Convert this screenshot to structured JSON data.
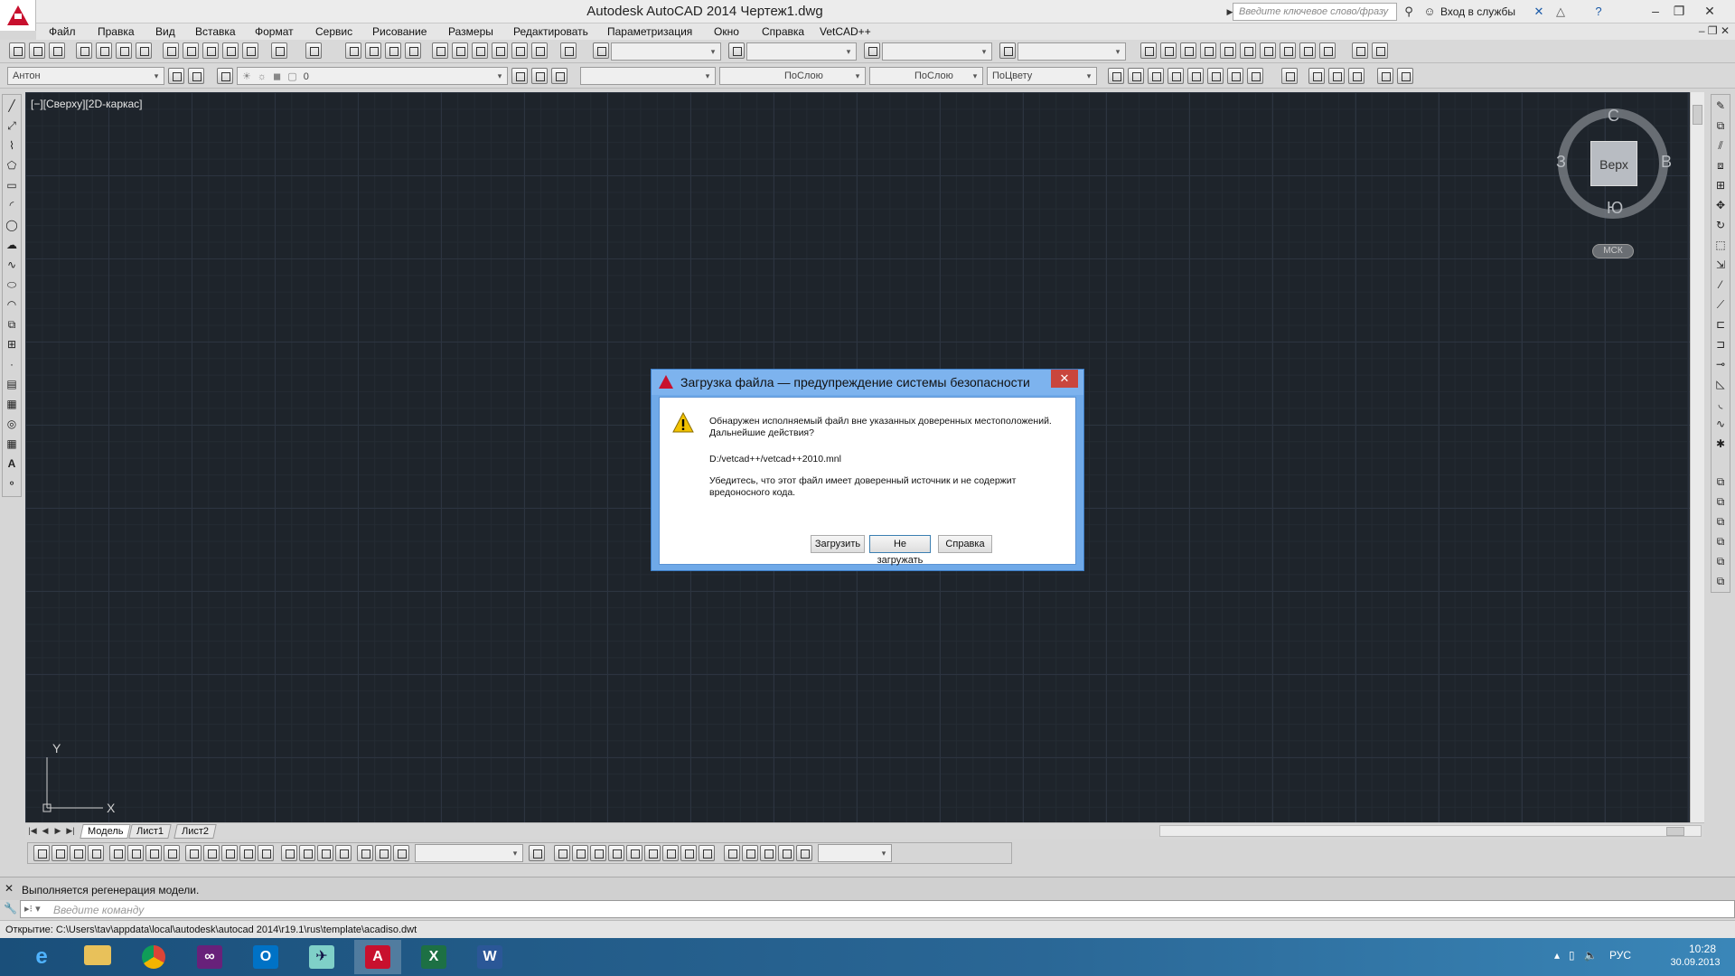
{
  "window": {
    "title": "Autodesk AutoCAD 2014    Чертеж1.dwg",
    "search_placeholder": "Введите ключевое слово/фразу",
    "signin_label": "Вход в службы"
  },
  "menu": [
    "Файл",
    "Правка",
    "Вид",
    "Вставка",
    "Формат",
    "Сервис",
    "Рисование",
    "Размеры",
    "Редактировать",
    "Параметризация",
    "Окно",
    "Справка",
    "VetCAD++"
  ],
  "toolbar2": {
    "workspace_combo": "Антон",
    "layer_combo": "0",
    "linetype_combo": "ПоСлою",
    "lineweight_combo": "ПоСлою",
    "color_combo": "ПоЦвету"
  },
  "viewport": {
    "label": "[−][Сверху][2D-каркас]",
    "viewcube": {
      "face": "Верх",
      "north": "С",
      "south": "Ю",
      "east": "В",
      "west": "З"
    },
    "wcs_label": "МСК",
    "ucs_x": "X",
    "ucs_y": "Y"
  },
  "tabs": [
    "Модель",
    "Лист1",
    "Лист2"
  ],
  "active_tab": "Модель",
  "command": {
    "history": "Выполняется регенерация модели.",
    "placeholder": "Введите команду"
  },
  "status": "Открытие: C:\\Users\\tav\\appdata\\local\\autodesk\\autocad 2014\\r19.1\\rus\\template\\acadiso.dwt",
  "dialog": {
    "title": "Загрузка файла — предупреждение системы безопасности",
    "message": "Обнаружен исполняемый файл вне указанных доверенных местоположений. Дальнейшие действия?",
    "path": "D:/vetcad++/vetcad++2010.mnl",
    "note": "Убедитесь, что этот файл имеет доверенный источник и не содержит вредоносного кода.",
    "buttons": {
      "load": "Загрузить",
      "dont_load": "Не загружать",
      "help": "Справка"
    }
  },
  "taskbar": {
    "apps": [
      "internet-explorer",
      "file-explorer",
      "chrome",
      "visual-studio",
      "outlook",
      "paper-plane-app",
      "autocad",
      "excel",
      "word"
    ],
    "language": "РУС",
    "time": "10:28",
    "date": "30.09.2013"
  },
  "colors": {
    "canvas_bg": "#1e242b",
    "dialog_frame": "#6fa9e8",
    "autocad_red": "#c8102e",
    "taskbar": "#2a6796"
  }
}
